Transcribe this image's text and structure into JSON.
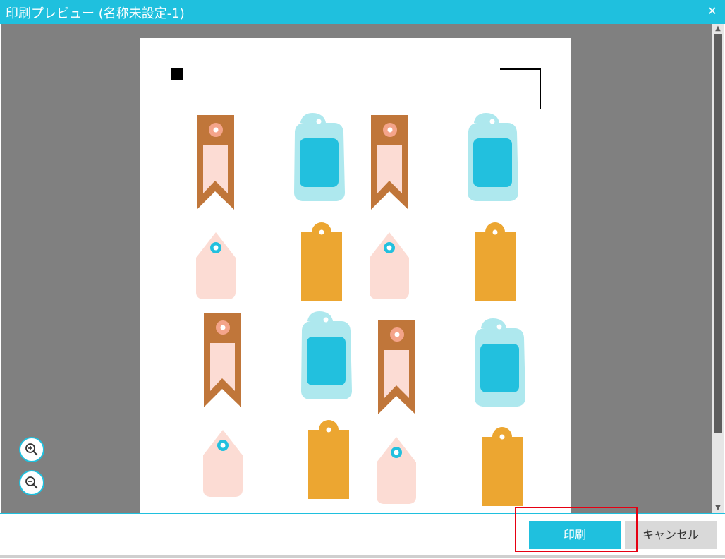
{
  "window": {
    "title": "印刷プレビュー (名称未設定-1)",
    "close_icon": "✕"
  },
  "buttons": {
    "print": "印刷",
    "cancel": "キャンセル"
  },
  "colors": {
    "accent": "#1fc0de",
    "canvas_gray": "#808080",
    "bookmark_brown": "#c0763a",
    "bookmark_pink": "#fcdcd4",
    "tag_light_blue": "#aee8ee",
    "tag_blue": "#22c0de",
    "tag_orange": "#eca631",
    "tag_pink": "#fcdcd4",
    "highlight_red": "#e60012"
  },
  "shapes": [
    "bookmark",
    "gift-tag",
    "bookmark",
    "gift-tag",
    "price-tag",
    "rect-tag",
    "price-tag",
    "rect-tag",
    "bookmark",
    "gift-tag",
    "bookmark",
    "gift-tag",
    "price-tag",
    "rect-tag",
    "price-tag",
    "rect-tag"
  ]
}
